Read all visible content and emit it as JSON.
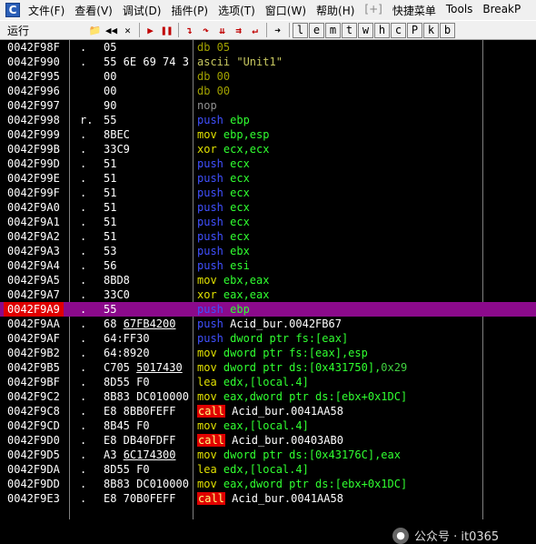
{
  "app": {
    "icon_letter": "C"
  },
  "menu": [
    "文件(F)",
    "查看(V)",
    "调试(D)",
    "插件(P)",
    "选项(T)",
    "窗口(W)",
    "帮助(H)",
    "[+]",
    "快捷菜单",
    "Tools",
    "BreakP"
  ],
  "toolbar": {
    "status": "运行",
    "letter_buttons": [
      "l",
      "e",
      "m",
      "t",
      "w",
      "h",
      "c",
      "P",
      "k",
      "b"
    ]
  },
  "rows": [
    {
      "addr": "0042F98F",
      "mark": ".",
      "hex": "05",
      "dis": [
        {
          "t": "db 05",
          "c": "db"
        }
      ]
    },
    {
      "addr": "0042F990",
      "mark": ".",
      "hex": "55 6E 69 74 3",
      "dis": [
        {
          "t": "ascii \"Unit1\"",
          "c": "str"
        }
      ]
    },
    {
      "addr": "0042F995",
      "mark": "",
      "hex": "00",
      "dis": [
        {
          "t": "db 00",
          "c": "db"
        }
      ]
    },
    {
      "addr": "0042F996",
      "mark": "",
      "hex": "00",
      "dis": [
        {
          "t": "db 00",
          "c": "db"
        }
      ]
    },
    {
      "addr": "0042F997",
      "mark": "",
      "hex": "90",
      "dis": [
        {
          "t": "nop",
          "c": "nop"
        }
      ]
    },
    {
      "addr": "0042F998",
      "mark": "r.",
      "hex": "55",
      "dis": [
        {
          "t": "push ",
          "c": "push"
        },
        {
          "t": "ebp",
          "c": "g"
        }
      ]
    },
    {
      "addr": "0042F999",
      "mark": ".",
      "hex": "8BEC",
      "dis": [
        {
          "t": "mov ",
          "c": "mov"
        },
        {
          "t": "ebp,esp",
          "c": "g"
        }
      ]
    },
    {
      "addr": "0042F99B",
      "mark": ".",
      "hex": "33C9",
      "dis": [
        {
          "t": "xor ",
          "c": "xor"
        },
        {
          "t": "ecx,ecx",
          "c": "g"
        }
      ]
    },
    {
      "addr": "0042F99D",
      "mark": ".",
      "hex": "51",
      "dis": [
        {
          "t": "push ",
          "c": "push"
        },
        {
          "t": "ecx",
          "c": "g"
        }
      ]
    },
    {
      "addr": "0042F99E",
      "mark": ".",
      "hex": "51",
      "dis": [
        {
          "t": "push ",
          "c": "push"
        },
        {
          "t": "ecx",
          "c": "g"
        }
      ]
    },
    {
      "addr": "0042F99F",
      "mark": ".",
      "hex": "51",
      "dis": [
        {
          "t": "push ",
          "c": "push"
        },
        {
          "t": "ecx",
          "c": "g"
        }
      ]
    },
    {
      "addr": "0042F9A0",
      "mark": ".",
      "hex": "51",
      "dis": [
        {
          "t": "push ",
          "c": "push"
        },
        {
          "t": "ecx",
          "c": "g"
        }
      ]
    },
    {
      "addr": "0042F9A1",
      "mark": ".",
      "hex": "51",
      "dis": [
        {
          "t": "push ",
          "c": "push"
        },
        {
          "t": "ecx",
          "c": "g"
        }
      ]
    },
    {
      "addr": "0042F9A2",
      "mark": ".",
      "hex": "51",
      "dis": [
        {
          "t": "push ",
          "c": "push"
        },
        {
          "t": "ecx",
          "c": "g"
        }
      ]
    },
    {
      "addr": "0042F9A3",
      "mark": ".",
      "hex": "53",
      "dis": [
        {
          "t": "push ",
          "c": "push"
        },
        {
          "t": "ebx",
          "c": "g"
        }
      ]
    },
    {
      "addr": "0042F9A4",
      "mark": ".",
      "hex": "56",
      "dis": [
        {
          "t": "push ",
          "c": "push"
        },
        {
          "t": "esi",
          "c": "g"
        }
      ]
    },
    {
      "addr": "0042F9A5",
      "mark": ".",
      "hex": "8BD8",
      "dis": [
        {
          "t": "mov ",
          "c": "mov"
        },
        {
          "t": "ebx,eax",
          "c": "g"
        }
      ]
    },
    {
      "addr": "0042F9A7",
      "mark": ".",
      "hex": "33C0",
      "dis": [
        {
          "t": "xor ",
          "c": "xor"
        },
        {
          "t": "eax,eax",
          "c": "g"
        }
      ]
    },
    {
      "addr": "0042F9A9",
      "mark": ".",
      "hex": "55",
      "sel": true,
      "dis": [
        {
          "t": "push ",
          "c": "push"
        },
        {
          "t": "ebp",
          "c": "g"
        }
      ]
    },
    {
      "addr": "0042F9AA",
      "mark": ".",
      "hex": "68 67FB4200",
      "hexul": "67FB4200",
      "dis": [
        {
          "t": "push ",
          "c": "push"
        },
        {
          "t": "Acid_bur.0042FB67",
          "c": "w"
        }
      ]
    },
    {
      "addr": "0042F9AF",
      "mark": ".",
      "hex": "64:FF30",
      "dis": [
        {
          "t": "push ",
          "c": "push"
        },
        {
          "t": "dword ptr fs:[eax]",
          "c": "g"
        }
      ]
    },
    {
      "addr": "0042F9B2",
      "mark": ".",
      "hex": "64:8920",
      "dis": [
        {
          "t": "mov ",
          "c": "mov"
        },
        {
          "t": "dword ptr fs:[eax],esp",
          "c": "g"
        }
      ]
    },
    {
      "addr": "0042F9B5",
      "mark": ".",
      "hex": "C705 5017430",
      "hexul": "5017430",
      "dis": [
        {
          "t": "mov ",
          "c": "mov"
        },
        {
          "t": "dword ptr ds:[0x431750],",
          "c": "g"
        },
        {
          "t": "0x29",
          "c": "num"
        }
      ]
    },
    {
      "addr": "0042F9BF",
      "mark": ".",
      "hex": "8D55 F0",
      "dis": [
        {
          "t": "lea ",
          "c": "lea"
        },
        {
          "t": "edx,[local.4]",
          "c": "g"
        }
      ]
    },
    {
      "addr": "0042F9C2",
      "mark": ".",
      "hex": "8B83 DC010000",
      "dis": [
        {
          "t": "mov ",
          "c": "mov"
        },
        {
          "t": "eax,dword ptr ds:[ebx+0x1DC]",
          "c": "g"
        }
      ]
    },
    {
      "addr": "0042F9C8",
      "mark": ".",
      "hex": "E8 8BB0FEFF",
      "dis": [
        {
          "t": "call",
          "c": "callkw"
        },
        {
          "t": " Acid_bur.0041AA58",
          "c": "w"
        }
      ]
    },
    {
      "addr": "0042F9CD",
      "mark": ".",
      "hex": "8B45 F0",
      "dis": [
        {
          "t": "mov ",
          "c": "mov"
        },
        {
          "t": "eax,[local.4]",
          "c": "g"
        }
      ]
    },
    {
      "addr": "0042F9D0",
      "mark": ".",
      "hex": "E8 DB40FDFF",
      "dis": [
        {
          "t": "call",
          "c": "callkw"
        },
        {
          "t": " Acid_bur.00403AB0",
          "c": "w"
        }
      ]
    },
    {
      "addr": "0042F9D5",
      "mark": ".",
      "hex": "A3 6C174300",
      "hexul": "6C174300",
      "dis": [
        {
          "t": "mov ",
          "c": "mov"
        },
        {
          "t": "dword ptr ds:[0x43176C],eax",
          "c": "g"
        }
      ]
    },
    {
      "addr": "0042F9DA",
      "mark": ".",
      "hex": "8D55 F0",
      "dis": [
        {
          "t": "lea ",
          "c": "lea"
        },
        {
          "t": "edx,[local.4]",
          "c": "g"
        }
      ]
    },
    {
      "addr": "0042F9DD",
      "mark": ".",
      "hex": "8B83 DC010000",
      "dis": [
        {
          "t": "mov ",
          "c": "mov"
        },
        {
          "t": "eax,dword ptr ds:[ebx+0x1DC]",
          "c": "g"
        }
      ]
    },
    {
      "addr": "0042F9E3",
      "mark": ".",
      "hex": "E8 70B0FEFF",
      "dis": [
        {
          "t": "call",
          "c": "callkw"
        },
        {
          "t": " Acid_bur.0041AA58",
          "c": "w"
        }
      ]
    }
  ],
  "watermark": {
    "text": "公众号 · it0365",
    "icon": "wechat-icon"
  }
}
